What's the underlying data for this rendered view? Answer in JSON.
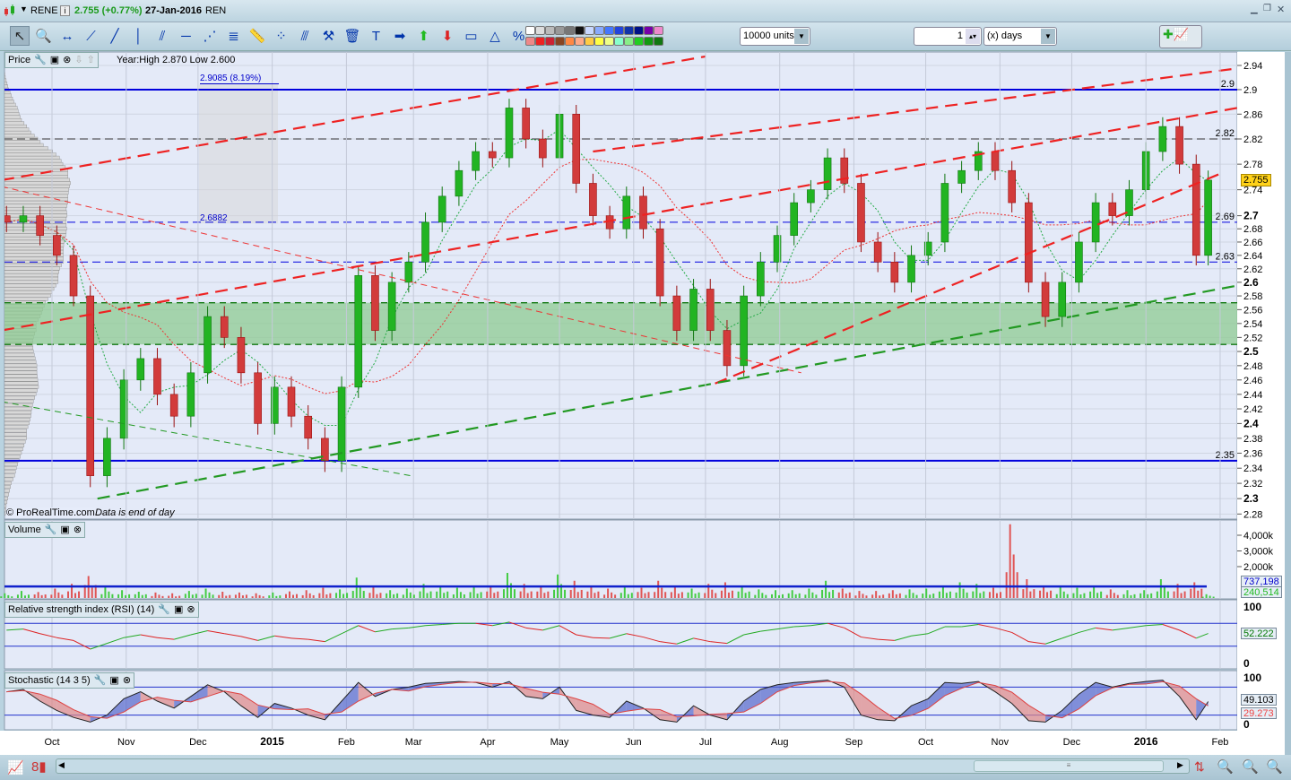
{
  "title": {
    "symbol": "RENE",
    "price": "2.755 (+0.77%)",
    "date": "27-Jan-2016",
    "market": "REN"
  },
  "toolbar": {
    "tools": [
      "pointer-icon",
      "zoom-icon",
      "horizontal-measure-icon",
      "segment-icon",
      "line-icon",
      "vertical-line-icon",
      "channel-icon",
      "horizontal-line-icon",
      "fan-icon",
      "fibonacci-icon",
      "ruler-icon",
      "point-icon",
      "parallel-icon",
      "tools-icon",
      "trash-icon",
      "text-icon",
      "arrow-right-icon",
      "arrow-up-icon",
      "arrow-down-icon",
      "rectangle-icon",
      "triangle-icon",
      "percent-icon"
    ],
    "colors_top": [
      "#ffffff",
      "#dddddd",
      "#bbbbbb",
      "#999999",
      "#777777",
      "#111111",
      "#c8d8ff",
      "#88aaff",
      "#4477ff",
      "#2244dd",
      "#1133aa",
      "#001188",
      "#7700aa",
      "#ee88cc"
    ],
    "colors_bottom": [
      "#ee8888",
      "#ee2222",
      "#cc2233",
      "#884422",
      "#ff8844",
      "#ffaa88",
      "#ffcc44",
      "#ffff44",
      "#eeff88",
      "#88ffcc",
      "#88ee88",
      "#22cc22",
      "#119911",
      "#117711"
    ],
    "units": "10000 units",
    "period_value": "1",
    "period_unit": "(x) days"
  },
  "price_panel": {
    "label": "Price",
    "info": "Year:High 2.870 Low 2.600",
    "measure_label": "2.9085 (8.19%)",
    "measure_low": "2.6882",
    "copyright": "© ProRealTime.com",
    "note": "Data is end of day",
    "last_price": "2.755",
    "hlines": [
      {
        "value": 2.9,
        "label": "2.9",
        "style": "solid",
        "color": "#0000dd"
      },
      {
        "value": 2.82,
        "label": "2.82",
        "style": "dash",
        "color": "#333333"
      },
      {
        "value": 2.69,
        "label": "2.69",
        "style": "dash",
        "color": "#0000dd"
      },
      {
        "value": 2.63,
        "label": "2.63",
        "style": "dash",
        "color": "#0000dd"
      },
      {
        "value": 2.35,
        "label": "2.35",
        "style": "solid",
        "color": "#0000dd"
      }
    ],
    "zone": {
      "low": 2.51,
      "high": 2.57,
      "color": "#8fcb93"
    }
  },
  "axis": {
    "price_ticks": [
      "2.94",
      "2.9",
      "2.86",
      "2.82",
      "2.78",
      "2.74",
      "2.7",
      "2.68",
      "2.66",
      "2.64",
      "2.62",
      "2.6",
      "2.58",
      "2.56",
      "2.54",
      "2.52",
      "2.5",
      "2.48",
      "2.46",
      "2.44",
      "2.42",
      "2.4",
      "2.38",
      "2.36",
      "2.34",
      "2.32",
      "2.3",
      "2.28"
    ],
    "bold_ticks": [
      "2.7",
      "2.6",
      "2.5",
      "2.4",
      "2.3"
    ],
    "months": [
      [
        "Oct",
        "2014-10-01"
      ],
      [
        "Nov",
        "2014-11-01"
      ],
      [
        "Dec",
        "2014-12-01"
      ],
      [
        "2015",
        "2015-01-01"
      ],
      [
        "Feb",
        "2015-02-01"
      ],
      [
        "Mar",
        "2015-03-01"
      ],
      [
        "Apr",
        "2015-04-01"
      ],
      [
        "May",
        "2015-05-01"
      ],
      [
        "Jun",
        "2015-06-01"
      ],
      [
        "Jul",
        "2015-07-01"
      ],
      [
        "Aug",
        "2015-08-01"
      ],
      [
        "Sep",
        "2015-09-01"
      ],
      [
        "Oct",
        "2015-10-01"
      ],
      [
        "Nov",
        "2015-11-01"
      ],
      [
        "Dec",
        "2015-12-01"
      ],
      [
        "2016",
        "2016-01-01"
      ],
      [
        "Feb",
        "2016-02-01"
      ]
    ],
    "bold_months": [
      "2015",
      "2016"
    ]
  },
  "chart_data": {
    "type": "candlestick",
    "scale": "log",
    "ylim": [
      2.28,
      2.95
    ],
    "dates": [
      "2014-09-12",
      "2014-09-19",
      "2014-09-26",
      "2014-10-03",
      "2014-10-10",
      "2014-10-17",
      "2014-10-24",
      "2014-10-31",
      "2014-11-07",
      "2014-11-14",
      "2014-11-21",
      "2014-11-28",
      "2014-12-05",
      "2014-12-12",
      "2014-12-19",
      "2014-12-26",
      "2015-01-02",
      "2015-01-09",
      "2015-01-16",
      "2015-01-23",
      "2015-01-30",
      "2015-02-06",
      "2015-02-13",
      "2015-02-20",
      "2015-02-27",
      "2015-03-06",
      "2015-03-13",
      "2015-03-20",
      "2015-03-27",
      "2015-04-03",
      "2015-04-10",
      "2015-04-17",
      "2015-04-24",
      "2015-05-01",
      "2015-05-08",
      "2015-05-15",
      "2015-05-22",
      "2015-05-29",
      "2015-06-05",
      "2015-06-12",
      "2015-06-19",
      "2015-06-26",
      "2015-07-03",
      "2015-07-10",
      "2015-07-17",
      "2015-07-24",
      "2015-07-31",
      "2015-08-07",
      "2015-08-14",
      "2015-08-21",
      "2015-08-28",
      "2015-09-04",
      "2015-09-11",
      "2015-09-18",
      "2015-09-25",
      "2015-10-02",
      "2015-10-09",
      "2015-10-16",
      "2015-10-23",
      "2015-10-30",
      "2015-11-06",
      "2015-11-13",
      "2015-11-20",
      "2015-11-27",
      "2015-12-04",
      "2015-12-11",
      "2015-12-18",
      "2015-12-25",
      "2016-01-01",
      "2016-01-08",
      "2016-01-15",
      "2016-01-22",
      "2016-01-27"
    ],
    "close": [
      2.69,
      2.7,
      2.67,
      2.64,
      2.58,
      2.33,
      2.38,
      2.46,
      2.49,
      2.44,
      2.41,
      2.47,
      2.55,
      2.52,
      2.47,
      2.4,
      2.45,
      2.41,
      2.38,
      2.35,
      2.45,
      2.61,
      2.53,
      2.6,
      2.63,
      2.69,
      2.73,
      2.77,
      2.8,
      2.79,
      2.87,
      2.82,
      2.79,
      2.86,
      2.75,
      2.7,
      2.68,
      2.73,
      2.68,
      2.58,
      2.53,
      2.59,
      2.53,
      2.48,
      2.58,
      2.63,
      2.67,
      2.72,
      2.74,
      2.79,
      2.75,
      2.66,
      2.63,
      2.6,
      2.64,
      2.66,
      2.75,
      2.77,
      2.8,
      2.77,
      2.72,
      2.6,
      2.55,
      2.6,
      2.66,
      2.72,
      2.7,
      2.74,
      2.8,
      2.84,
      2.78,
      2.64,
      2.755
    ],
    "volume_k": [
      300,
      450,
      380,
      600,
      900,
      1400,
      700,
      500,
      400,
      350,
      300,
      450,
      600,
      400,
      350,
      300,
      350,
      420,
      500,
      650,
      550,
      1300,
      700,
      500,
      600,
      900,
      700,
      650,
      800,
      700,
      1600,
      900,
      700,
      1500,
      1100,
      700,
      600,
      700,
      650,
      1100,
      800,
      600,
      900,
      1000,
      700,
      550,
      500,
      500,
      600,
      1100,
      600,
      450,
      450,
      500,
      550,
      600,
      700,
      1000,
      900,
      650,
      4700,
      1200,
      800,
      700,
      650,
      700,
      550,
      500,
      500,
      1200,
      900,
      1000,
      240
    ],
    "volume_avg_k": 737,
    "rsi": [
      58,
      60,
      52,
      45,
      40,
      25,
      35,
      45,
      50,
      45,
      42,
      50,
      57,
      52,
      47,
      40,
      48,
      44,
      42,
      38,
      52,
      66,
      55,
      60,
      62,
      66,
      68,
      70,
      70,
      66,
      72,
      62,
      58,
      66,
      50,
      45,
      44,
      52,
      46,
      38,
      34,
      44,
      38,
      35,
      50,
      56,
      60,
      64,
      66,
      70,
      62,
      46,
      42,
      40,
      48,
      52,
      64,
      64,
      68,
      62,
      54,
      38,
      34,
      44,
      54,
      62,
      58,
      62,
      66,
      68,
      58,
      44,
      52.2
    ],
    "stoch_k": [
      70,
      75,
      50,
      30,
      15,
      5,
      20,
      55,
      70,
      50,
      35,
      60,
      85,
      70,
      40,
      15,
      45,
      35,
      20,
      10,
      50,
      90,
      60,
      75,
      80,
      88,
      90,
      92,
      90,
      80,
      92,
      60,
      55,
      80,
      30,
      20,
      15,
      50,
      35,
      10,
      5,
      40,
      20,
      10,
      50,
      75,
      85,
      90,
      92,
      95,
      80,
      20,
      10,
      8,
      40,
      55,
      90,
      88,
      92,
      70,
      45,
      8,
      5,
      30,
      65,
      90,
      80,
      88,
      92,
      95,
      60,
      10,
      49.1
    ],
    "trendlines": [
      {
        "from": [
          "2014-09-10",
          2.755
        ],
        "to": [
          "2015-07-01",
          2.955
        ],
        "color": "#ee2222"
      },
      {
        "from": [
          "2014-09-10",
          2.53
        ],
        "to": [
          "2016-02-08",
          2.87
        ],
        "color": "#ee2222"
      },
      {
        "from": [
          "2015-05-15",
          2.8
        ],
        "to": [
          "2016-02-08",
          2.935
        ],
        "color": "#ee2222"
      },
      {
        "from": [
          "2015-07-05",
          2.455
        ],
        "to": [
          "2016-02-01",
          2.765
        ],
        "color": "#ee2222"
      },
      {
        "from": [
          "2014-10-20",
          2.3
        ],
        "to": [
          "2016-02-08",
          2.595
        ],
        "color": "#229922"
      }
    ],
    "thin_lines": [
      {
        "from": [
          "2014-09-10",
          2.745
        ],
        "to": [
          "2015-08-10",
          2.47
        ],
        "color": "#ee3333"
      },
      {
        "from": [
          "2014-09-10",
          2.43
        ],
        "to": [
          "2015-02-28",
          2.33
        ],
        "color": "#229922"
      }
    ]
  },
  "volume_panel": {
    "label": "Volume",
    "ticks": [
      "4,000k",
      "3,000k",
      "2,000k"
    ],
    "avg_value": "737,198",
    "last_value": "240,514"
  },
  "rsi_panel": {
    "label": "Relative strength index (RSI) (14)",
    "ticks": [
      "100",
      "0"
    ],
    "value": "52.222"
  },
  "stoch_panel": {
    "label": "Stochastic (14 3 5)",
    "ticks": [
      "100",
      "0"
    ],
    "k_value": "49.103",
    "d_value": "29.273"
  }
}
